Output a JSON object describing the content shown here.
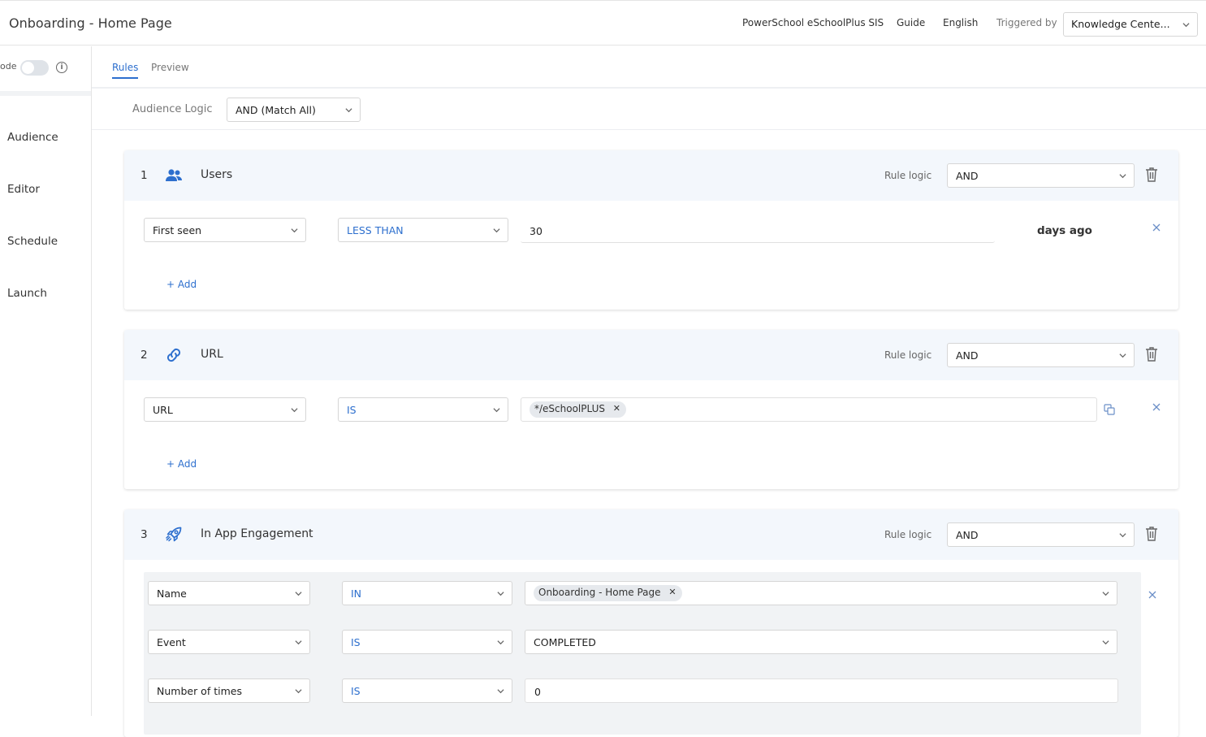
{
  "header": {
    "title": "Onboarding - Home Page",
    "app_name": "PowerSchool eSchoolPlus SIS",
    "guide_label": "Guide",
    "language": "English",
    "triggered_by_label": "Triggered by",
    "triggered_by_value": "Knowledge Cente..."
  },
  "sidebar": {
    "mode_label": "ode",
    "mode_toggle_on": false,
    "items": [
      {
        "label": "Audience"
      },
      {
        "label": "Editor"
      },
      {
        "label": "Schedule"
      },
      {
        "label": "Launch"
      }
    ]
  },
  "tabs": [
    {
      "label": "Rules",
      "active": true
    },
    {
      "label": "Preview",
      "active": false
    }
  ],
  "audience_logic": {
    "label": "Audience Logic",
    "value": "AND (Match All)"
  },
  "rules": [
    {
      "number": "1",
      "icon": "users-icon",
      "title": "Users",
      "rule_logic_label": "Rule logic",
      "rule_logic_value": "AND",
      "conditions": [
        {
          "field": "First seen",
          "operator": "LESS THAN",
          "value": "30",
          "suffix": "days ago"
        }
      ],
      "add_label": "+ Add"
    },
    {
      "number": "2",
      "icon": "link-icon",
      "title": "URL",
      "rule_logic_label": "Rule logic",
      "rule_logic_value": "AND",
      "conditions": [
        {
          "field": "URL",
          "operator": "IS",
          "chip": "*/eSchoolPLUS"
        }
      ],
      "add_label": "+ Add"
    },
    {
      "number": "3",
      "icon": "rocket-icon",
      "title": "In App Engagement",
      "rule_logic_label": "Rule logic",
      "rule_logic_value": "AND",
      "conditions": [
        {
          "field": "Name",
          "operator": "IN",
          "chip": "Onboarding - Home Page"
        },
        {
          "field": "Event",
          "operator": "IS",
          "value": "COMPLETED"
        },
        {
          "field": "Number of times",
          "operator": "IS",
          "value": "0"
        }
      ]
    }
  ],
  "colors": {
    "accent": "#2d6fce",
    "card_header_bg": "#f3f7fc",
    "engagement_bg": "#f1f3f5"
  }
}
